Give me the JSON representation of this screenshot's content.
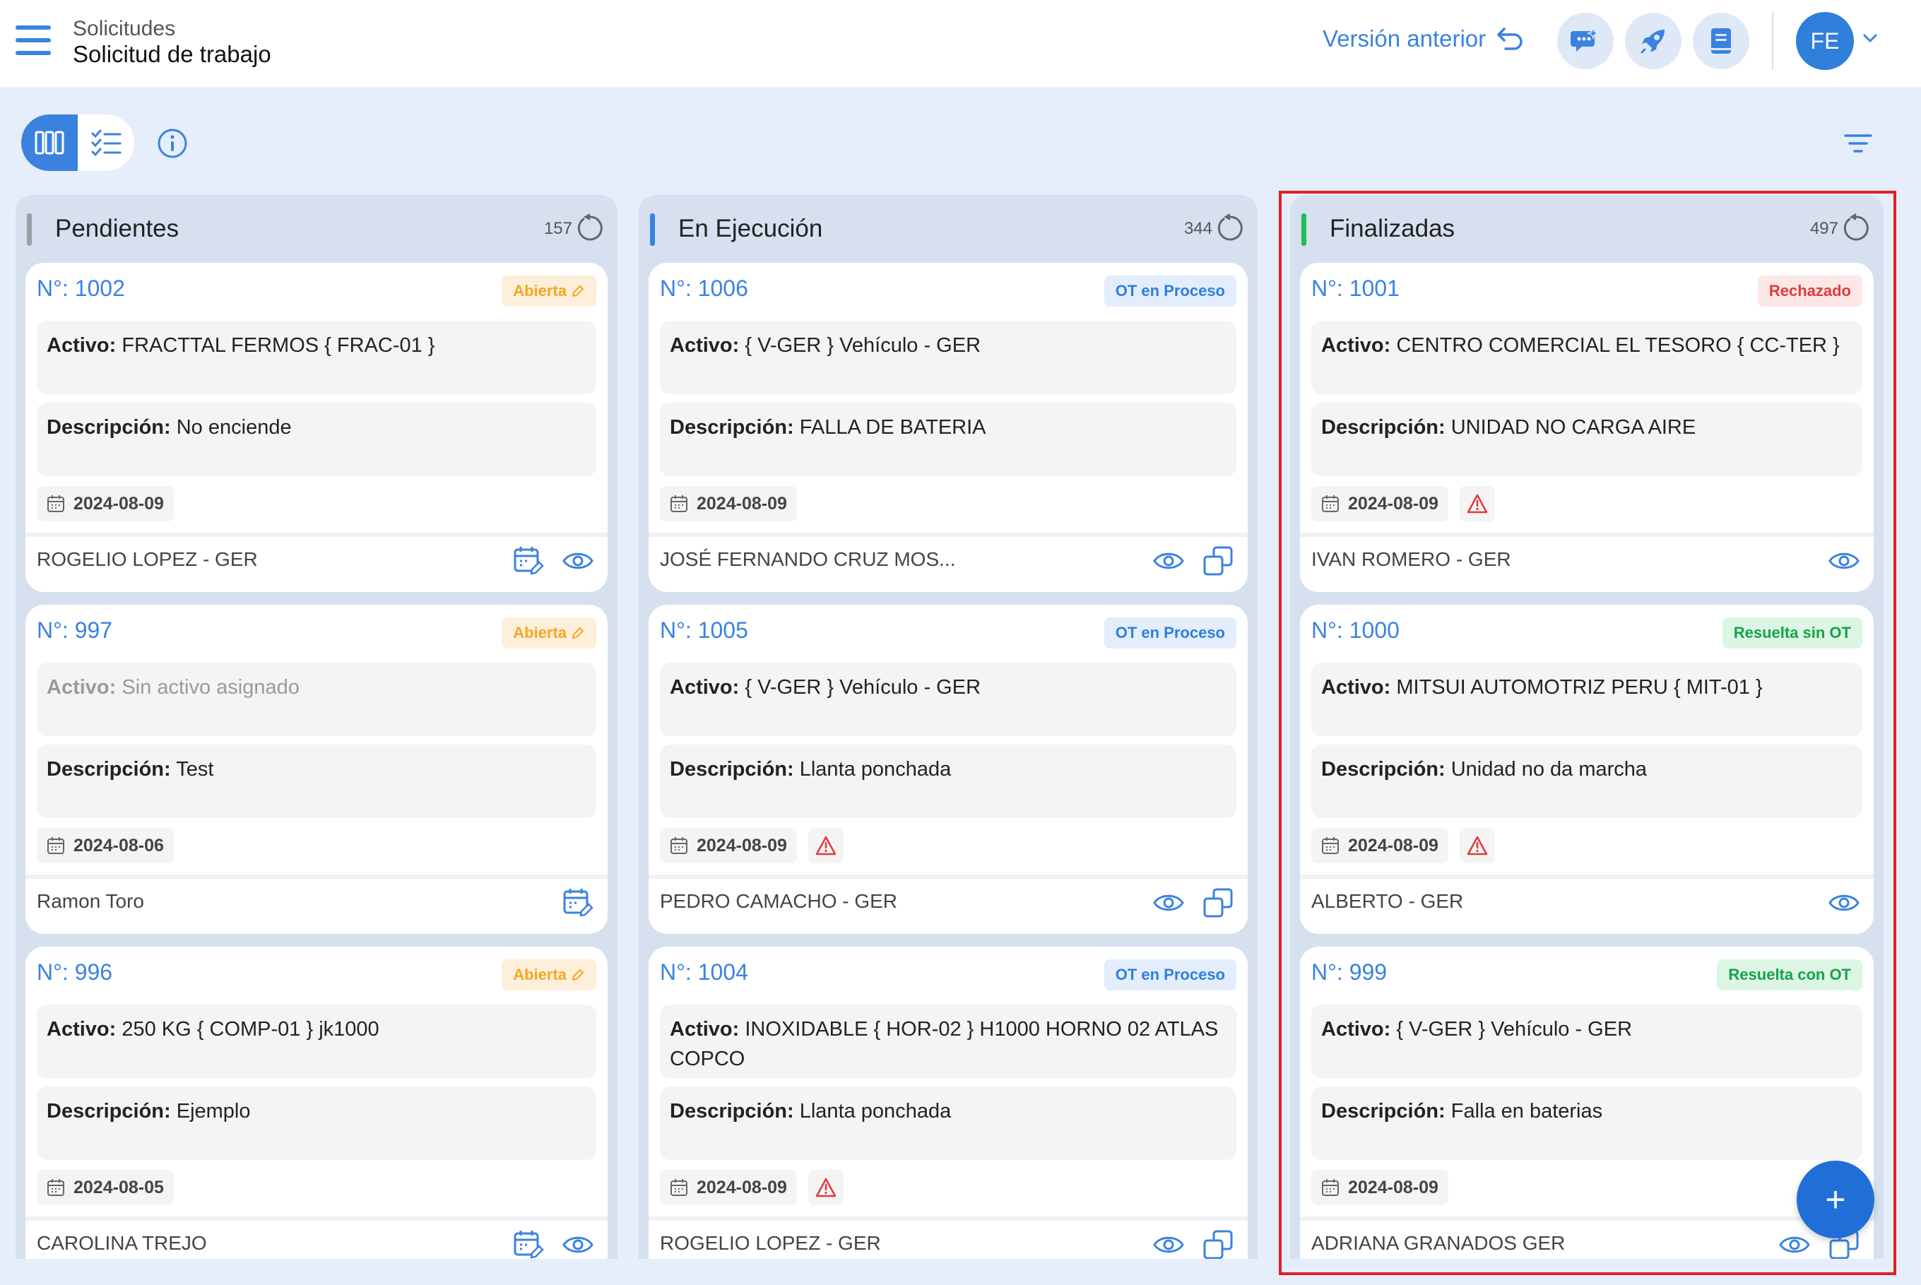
{
  "header": {
    "breadcrumb_parent": "Solicitudes",
    "title": "Solicitud de trabajo",
    "previous_version_label": "Versión anterior",
    "user_initials": "FE"
  },
  "colors": {
    "accent": "#3b82e0",
    "pendientes": "#9aa0a6",
    "en_ejecucion": "#3b82e0",
    "finalizadas": "#1fbf55",
    "highlight": "#e01f26"
  },
  "columns": [
    {
      "title": "Pendientes",
      "count": "157",
      "cards": [
        {
          "number": "N°: 1002",
          "status": "Abierta",
          "activo_label": "Activo:",
          "activo": "FRACTTAL FERMOS   { FRAC-01 }",
          "desc_label": "Descripción:",
          "desc": "No enciende",
          "date": "2024-08-09",
          "user": "ROGELIO LOPEZ - GER"
        },
        {
          "number": "N°: 997",
          "status": "Abierta",
          "activo_label": "Activo:",
          "activo": "Sin activo asignado",
          "desc_label": "Descripción:",
          "desc": "Test",
          "date": "2024-08-06",
          "user": "Ramon Toro"
        },
        {
          "number": "N°: 996",
          "status": "Abierta",
          "activo_label": "Activo:",
          "activo": "250 KG { COMP-01 } jk1000",
          "desc_label": "Descripción:",
          "desc": "Ejemplo",
          "date": "2024-08-05",
          "user": "CAROLINA TREJO"
        }
      ]
    },
    {
      "title": "En Ejecución",
      "count": "344",
      "cards": [
        {
          "number": "N°: 1006",
          "status": "OT en Proceso",
          "activo_label": "Activo:",
          "activo": " { V-GER }  Vehículo - GER",
          "desc_label": "Descripción:",
          "desc": "FALLA DE BATERIA",
          "date": "2024-08-09",
          "user": "JOSÉ FERNANDO CRUZ MOS..."
        },
        {
          "number": "N°: 1005",
          "status": "OT en Proceso",
          "activo_label": "Activo:",
          "activo": " { V-GER }  Vehículo - GER",
          "desc_label": "Descripción:",
          "desc": "Llanta ponchada",
          "date": "2024-08-09",
          "user": "PEDRO CAMACHO - GER"
        },
        {
          "number": "N°: 1004",
          "status": "OT en Proceso",
          "activo_label": "Activo:",
          "activo": "INOXIDABLE { HOR-02 } H1000 HORNO 02 ATLAS COPCO",
          "desc_label": "Descripción:",
          "desc": "Llanta ponchada",
          "date": "2024-08-09",
          "user": "ROGELIO LOPEZ - GER"
        }
      ]
    },
    {
      "title": "Finalizadas",
      "count": "497",
      "cards": [
        {
          "number": "N°: 1001",
          "status": "Rechazado",
          "activo_label": "Activo:",
          "activo": "CENTRO COMERCIAL EL TESORO   { CC-TER }",
          "desc_label": "Descripción:",
          "desc": "UNIDAD NO CARGA AIRE",
          "date": "2024-08-09",
          "user": "IVAN ROMERO - GER"
        },
        {
          "number": "N°: 1000",
          "status": "Resuelta sin OT",
          "activo_label": "Activo:",
          "activo": "MITSUI AUTOMOTRIZ  PERU { MIT-01 }",
          "desc_label": "Descripción:",
          "desc": "Unidad no da marcha",
          "date": "2024-08-09",
          "user": "ALBERTO - GER"
        },
        {
          "number": "N°: 999",
          "status": "Resuelta con OT",
          "activo_label": "Activo:",
          "activo": " { V-GER }  Vehículo - GER",
          "desc_label": "Descripción:",
          "desc": "Falla en baterias",
          "date": "2024-08-09",
          "user": "ADRIANA GRANADOS GER"
        }
      ]
    }
  ],
  "fab_label": "+"
}
